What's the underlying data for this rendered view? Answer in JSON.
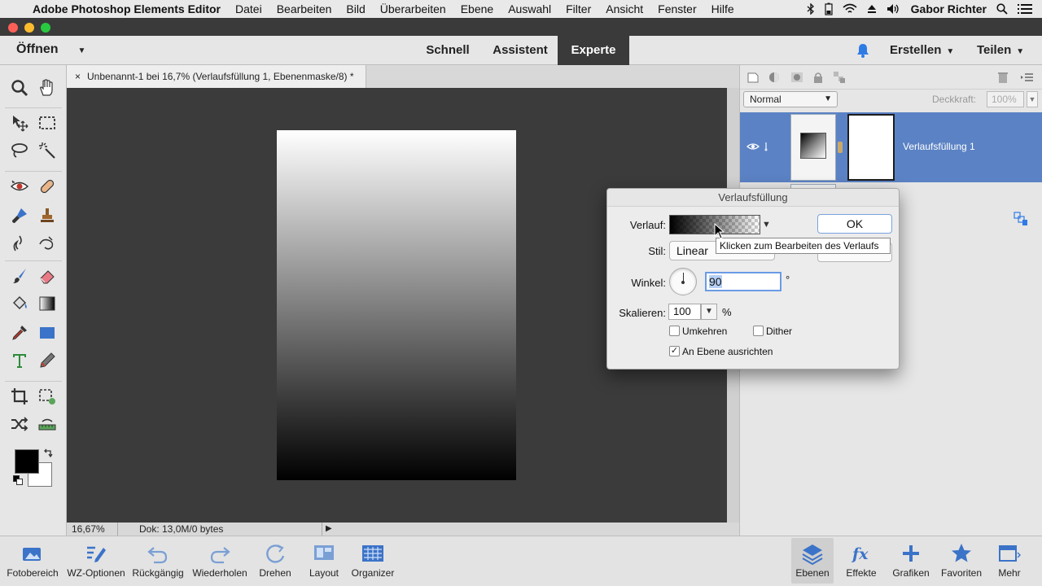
{
  "menubar": {
    "app_name": "Adobe Photoshop Elements Editor",
    "items": [
      "Datei",
      "Bearbeiten",
      "Bild",
      "Überarbeiten",
      "Ebene",
      "Auswahl",
      "Filter",
      "Ansicht",
      "Fenster",
      "Hilfe"
    ],
    "user": "Gabor Richter",
    "icons": [
      "apple-icon",
      "bluetooth-icon",
      "battery-icon",
      "wifi-icon",
      "eject-icon",
      "volume-icon",
      "search-icon",
      "list-icon"
    ]
  },
  "topbar": {
    "open_label": "Öffnen",
    "modes": [
      "Schnell",
      "Assistent",
      "Experte"
    ],
    "active_mode": "Experte",
    "create_label": "Erstellen",
    "share_label": "Teilen"
  },
  "document": {
    "tab_close": "×",
    "tab_title": "Unbenannt-1 bei 16,7% (Verlaufsfüllung 1, Ebenenmaske/8) *"
  },
  "status": {
    "zoom": "16,67%",
    "doc_info": "Dok: 13,0M/0 bytes"
  },
  "layers": {
    "blend_mode": "Normal",
    "opacity_label": "Deckkraft:",
    "opacity_value": "100%",
    "layer_name": "Verlaufsfüllung 1"
  },
  "dialog": {
    "title": "Verlaufsfüllung",
    "gradient_label": "Verlauf:",
    "style_label": "Stil:",
    "style_value": "Linear",
    "angle_label": "Winkel:",
    "angle_value": "90",
    "degree": "°",
    "scale_label": "Skalieren:",
    "scale_value": "100",
    "percent": "%",
    "reverse_label": "Umkehren",
    "reverse_checked": false,
    "dither_label": "Dither",
    "dither_checked": false,
    "align_label": "An Ebene ausrichten",
    "align_checked": true,
    "checkmark": "✓",
    "ok_label": "OK"
  },
  "tooltip": {
    "text": "Klicken zum Bearbeiten des Verlaufs"
  },
  "bottombar": {
    "left": [
      {
        "label": "Fotobereich",
        "icon": "photo-bin-icon"
      },
      {
        "label": "WZ-Optionen",
        "icon": "tool-options-icon"
      },
      {
        "label": "Rückgängig",
        "icon": "undo-icon"
      },
      {
        "label": "Wiederholen",
        "icon": "redo-icon"
      },
      {
        "label": "Drehen",
        "icon": "rotate-icon"
      },
      {
        "label": "Layout",
        "icon": "layout-icon"
      },
      {
        "label": "Organizer",
        "icon": "organizer-icon"
      }
    ],
    "right": [
      {
        "label": "Ebenen",
        "icon": "layers-icon"
      },
      {
        "label": "Effekte",
        "icon": "fx-icon"
      },
      {
        "label": "Grafiken",
        "icon": "plus-icon"
      },
      {
        "label": "Favoriten",
        "icon": "star-icon"
      },
      {
        "label": "Mehr",
        "icon": "more-icon"
      }
    ]
  },
  "colors": {
    "accent_blue": "#5b82c4",
    "ok_border": "#7aa2e0",
    "notification_blue": "#2f7be5"
  }
}
